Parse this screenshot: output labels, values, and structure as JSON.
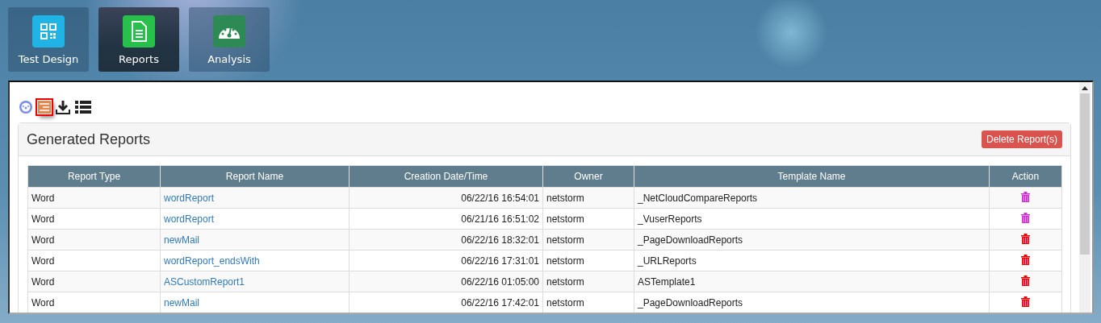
{
  "nav_tiles": [
    {
      "label": "Test Design",
      "kind": "qr",
      "selected": false
    },
    {
      "label": "Reports",
      "kind": "document",
      "selected": true
    },
    {
      "label": "Analysis",
      "kind": "gauge",
      "selected": false
    }
  ],
  "toolbar": [
    {
      "kind": "gauge",
      "selected": false
    },
    {
      "kind": "report",
      "selected": true
    },
    {
      "kind": "download",
      "selected": false
    },
    {
      "kind": "list",
      "selected": false
    }
  ],
  "panel": {
    "title": "Generated Reports",
    "delete_button": "Delete Report(s)"
  },
  "table": {
    "columns": [
      "Report Type",
      "Report Name",
      "Creation Date/Time",
      "Owner",
      "Template Name",
      "Action"
    ],
    "rows": [
      {
        "type": "Word",
        "name": "wordReport",
        "created": "06/22/16 16:54:01",
        "owner": "netstorm",
        "template": "_NetCloudCompareReports",
        "color": "#cc33cc"
      },
      {
        "type": "Word",
        "name": "wordReport",
        "created": "06/21/16 16:51:02",
        "owner": "netstorm",
        "template": "_VuserReports",
        "color": "#cc33cc"
      },
      {
        "type": "Word",
        "name": "newMail",
        "created": "06/22/16 18:32:01",
        "owner": "netstorm",
        "template": "_PageDownloadReports",
        "color": "#ee0000"
      },
      {
        "type": "Word",
        "name": "wordReport_endsWith",
        "created": "06/22/16 17:31:01",
        "owner": "netstorm",
        "template": "_URLReports",
        "color": "#ee0000"
      },
      {
        "type": "Word",
        "name": "ASCustomReport1",
        "created": "06/22/16 01:05:00",
        "owner": "netstorm",
        "template": "ASTemplate1",
        "color": "#ee0000"
      },
      {
        "type": "Word",
        "name": "newMail",
        "created": "06/22/16 17:42:01",
        "owner": "netstorm",
        "template": "_PageDownloadReports",
        "color": "#ee0000"
      }
    ]
  }
}
